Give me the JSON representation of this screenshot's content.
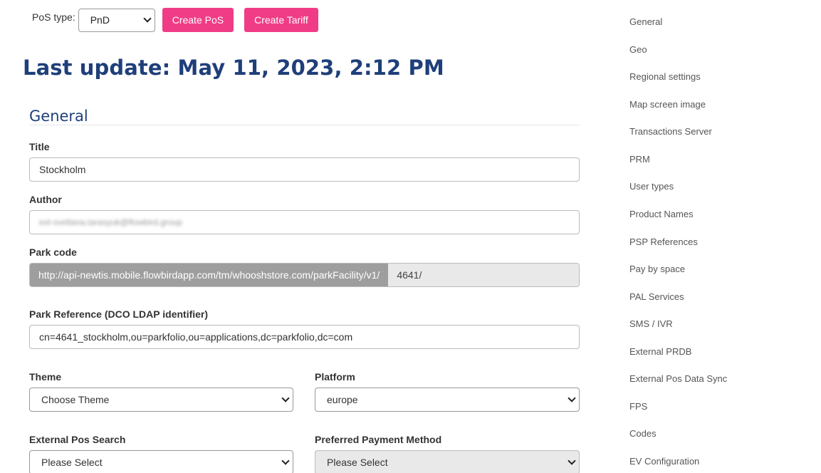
{
  "toolbar": {
    "pos_type_label": "PoS type:",
    "pos_type_value": "PnD",
    "create_pos_label": "Create PoS",
    "create_tariff_label": "Create Tariff"
  },
  "last_update": "Last update: May 11, 2023, 2:12 PM",
  "section": {
    "title": "General"
  },
  "fields": {
    "title_label": "Title",
    "title_value": "Stockholm",
    "author_label": "Author",
    "author_value": "ext-svetlana.tarasyuk@flowbird.group",
    "park_code_label": "Park code",
    "park_code_prefix": "http://api-newtis.mobile.flowbirdapp.com/tm/whooshstore.com/parkFacility/v1/",
    "park_code_value": "4641/",
    "park_reference_label": "Park Reference (DCO LDAP identifier)",
    "park_reference_value": "cn=4641_stockholm,ou=parkfolio,ou=applications,dc=parkfolio,dc=com",
    "theme_label": "Theme",
    "theme_value": "Choose Theme",
    "platform_label": "Platform",
    "platform_value": "europe",
    "external_pos_search_label": "External Pos Search",
    "external_pos_search_value": "Please Select",
    "preferred_payment_label": "Preferred Payment Method",
    "preferred_payment_value": "Please Select"
  },
  "sidenav": {
    "items": [
      "General",
      "Geo",
      "Regional settings",
      "Map screen image",
      "Transactions Server",
      "PRM",
      "User types",
      "Product Names",
      "PSP References",
      "Pay by space",
      "PAL Services",
      "SMS / IVR",
      "External PRDB",
      "External Pos Data Sync",
      "FPS",
      "Codes",
      "EV Configuration"
    ]
  },
  "colors": {
    "accent": "#f03c86",
    "heading": "#1f3f7a",
    "prefix_bg": "#9e9e9e"
  }
}
